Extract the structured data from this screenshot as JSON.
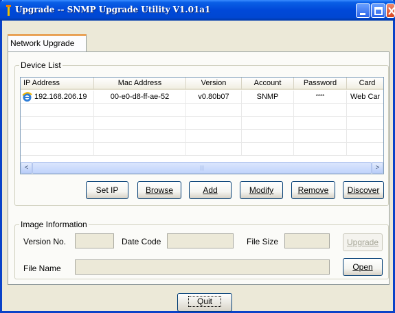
{
  "window": {
    "title": "Upgrade -- SNMP Upgrade Utility V1.01a1",
    "controls": [
      "minimize-icon",
      "maximize-icon",
      "close-icon"
    ]
  },
  "tabs": [
    {
      "label": "Network Upgrade",
      "selected": true
    }
  ],
  "device_list": {
    "legend": "Device List",
    "columns": [
      "IP Address",
      "Mac Address",
      "Version",
      "Account",
      "Password",
      "Card"
    ],
    "rows": [
      {
        "ip": "192.168.206.19",
        "mac": "00-e0-d8-ff-ae-52",
        "version": "v0.80b07",
        "account": "SNMP",
        "password": "****",
        "card": "Web Car"
      }
    ],
    "scroll_thumb": "|||",
    "scroll_left": "<",
    "scroll_right": ">"
  },
  "buttons": {
    "set_ip": "Set IP",
    "browse": "Browse",
    "add": "Add",
    "modify": "Modify",
    "remove": "Remove",
    "discover": "Discover"
  },
  "image_info": {
    "legend": "Image Information",
    "version_label": "Version No.",
    "date_label": "Date Code",
    "size_label": "File Size",
    "filename_label": "File Name",
    "upgrade": "Upgrade",
    "open": "Open"
  },
  "quit": "Quit",
  "colors": {
    "titlebar": "#0a5fe6",
    "tab_highlight": "#e68b2c"
  }
}
